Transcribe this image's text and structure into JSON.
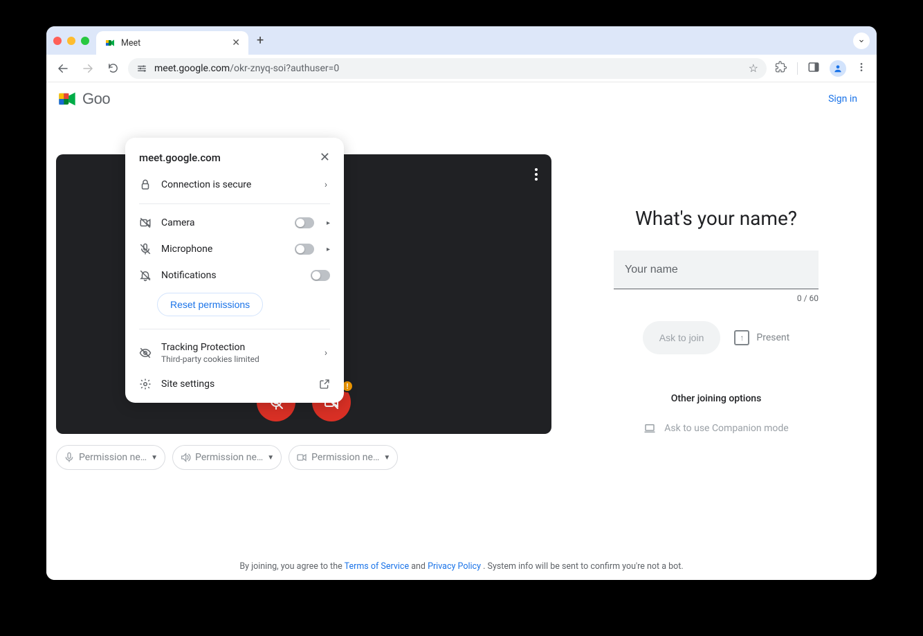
{
  "tab": {
    "title": "Meet"
  },
  "url": {
    "host": "meet.google.com",
    "path": "/okr-znyq-soi?authuser=0"
  },
  "header": {
    "brand_partial": "Goo",
    "signin": "Sign in"
  },
  "popover": {
    "host": "meet.google.com",
    "secure": "Connection is secure",
    "camera": "Camera",
    "microphone": "Microphone",
    "notifications": "Notifications",
    "reset": "Reset permissions",
    "tracking_title": "Tracking Protection",
    "tracking_sub": "Third-party cookies limited",
    "site_settings": "Site settings"
  },
  "pills": {
    "mic": "Permission ne…",
    "speaker": "Permission ne…",
    "camera": "Permission ne…"
  },
  "join": {
    "question": "What's your name?",
    "placeholder": "Your name",
    "counter": "0 / 60",
    "ask": "Ask to join",
    "present": "Present",
    "other_title": "Other joining options",
    "companion": "Ask to use Companion mode"
  },
  "footer": {
    "t1": "By joining, you agree to the ",
    "tos": "Terms of Service",
    "and": " and ",
    "pp": "Privacy Policy",
    "t2": ". System info will be sent to confirm you're not a bot."
  }
}
